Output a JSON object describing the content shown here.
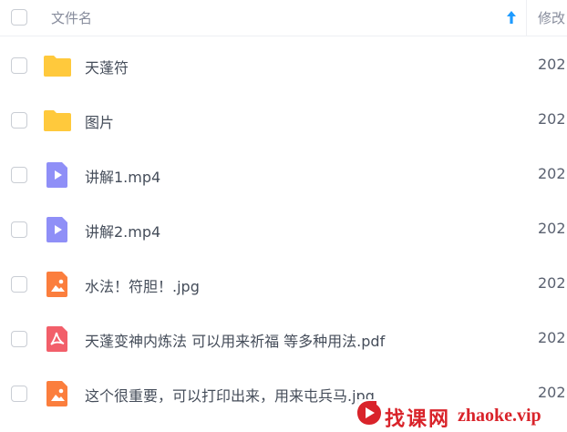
{
  "header": {
    "name_label": "文件名",
    "modified_label": "修改"
  },
  "files": [
    {
      "name": "天蓬符",
      "type": "folder",
      "date": "202"
    },
    {
      "name": "图片",
      "type": "folder",
      "date": "202"
    },
    {
      "name": "讲解1.mp4",
      "type": "video",
      "date": "202"
    },
    {
      "name": "讲解2.mp4",
      "type": "video",
      "date": "202"
    },
    {
      "name": "水法！符胆！.jpg",
      "type": "image",
      "date": "202"
    },
    {
      "name": "天蓬变神内炼法 可以用来祈福 等多种用法.pdf",
      "type": "pdf",
      "date": "202"
    },
    {
      "name": "这个很重要，可以打印出来，用来屯兵马.jpg",
      "type": "image",
      "date": "202"
    }
  ],
  "colors": {
    "folder": "#ffc93c",
    "video": "#8f8ff7",
    "image": "#fb7e3d",
    "pdf": "#f25f6a",
    "sort_arrow": "#1e9bff",
    "watermark": "#d9232a"
  },
  "watermark": {
    "cn": "找课网",
    "en": "zhaoke.vip"
  }
}
